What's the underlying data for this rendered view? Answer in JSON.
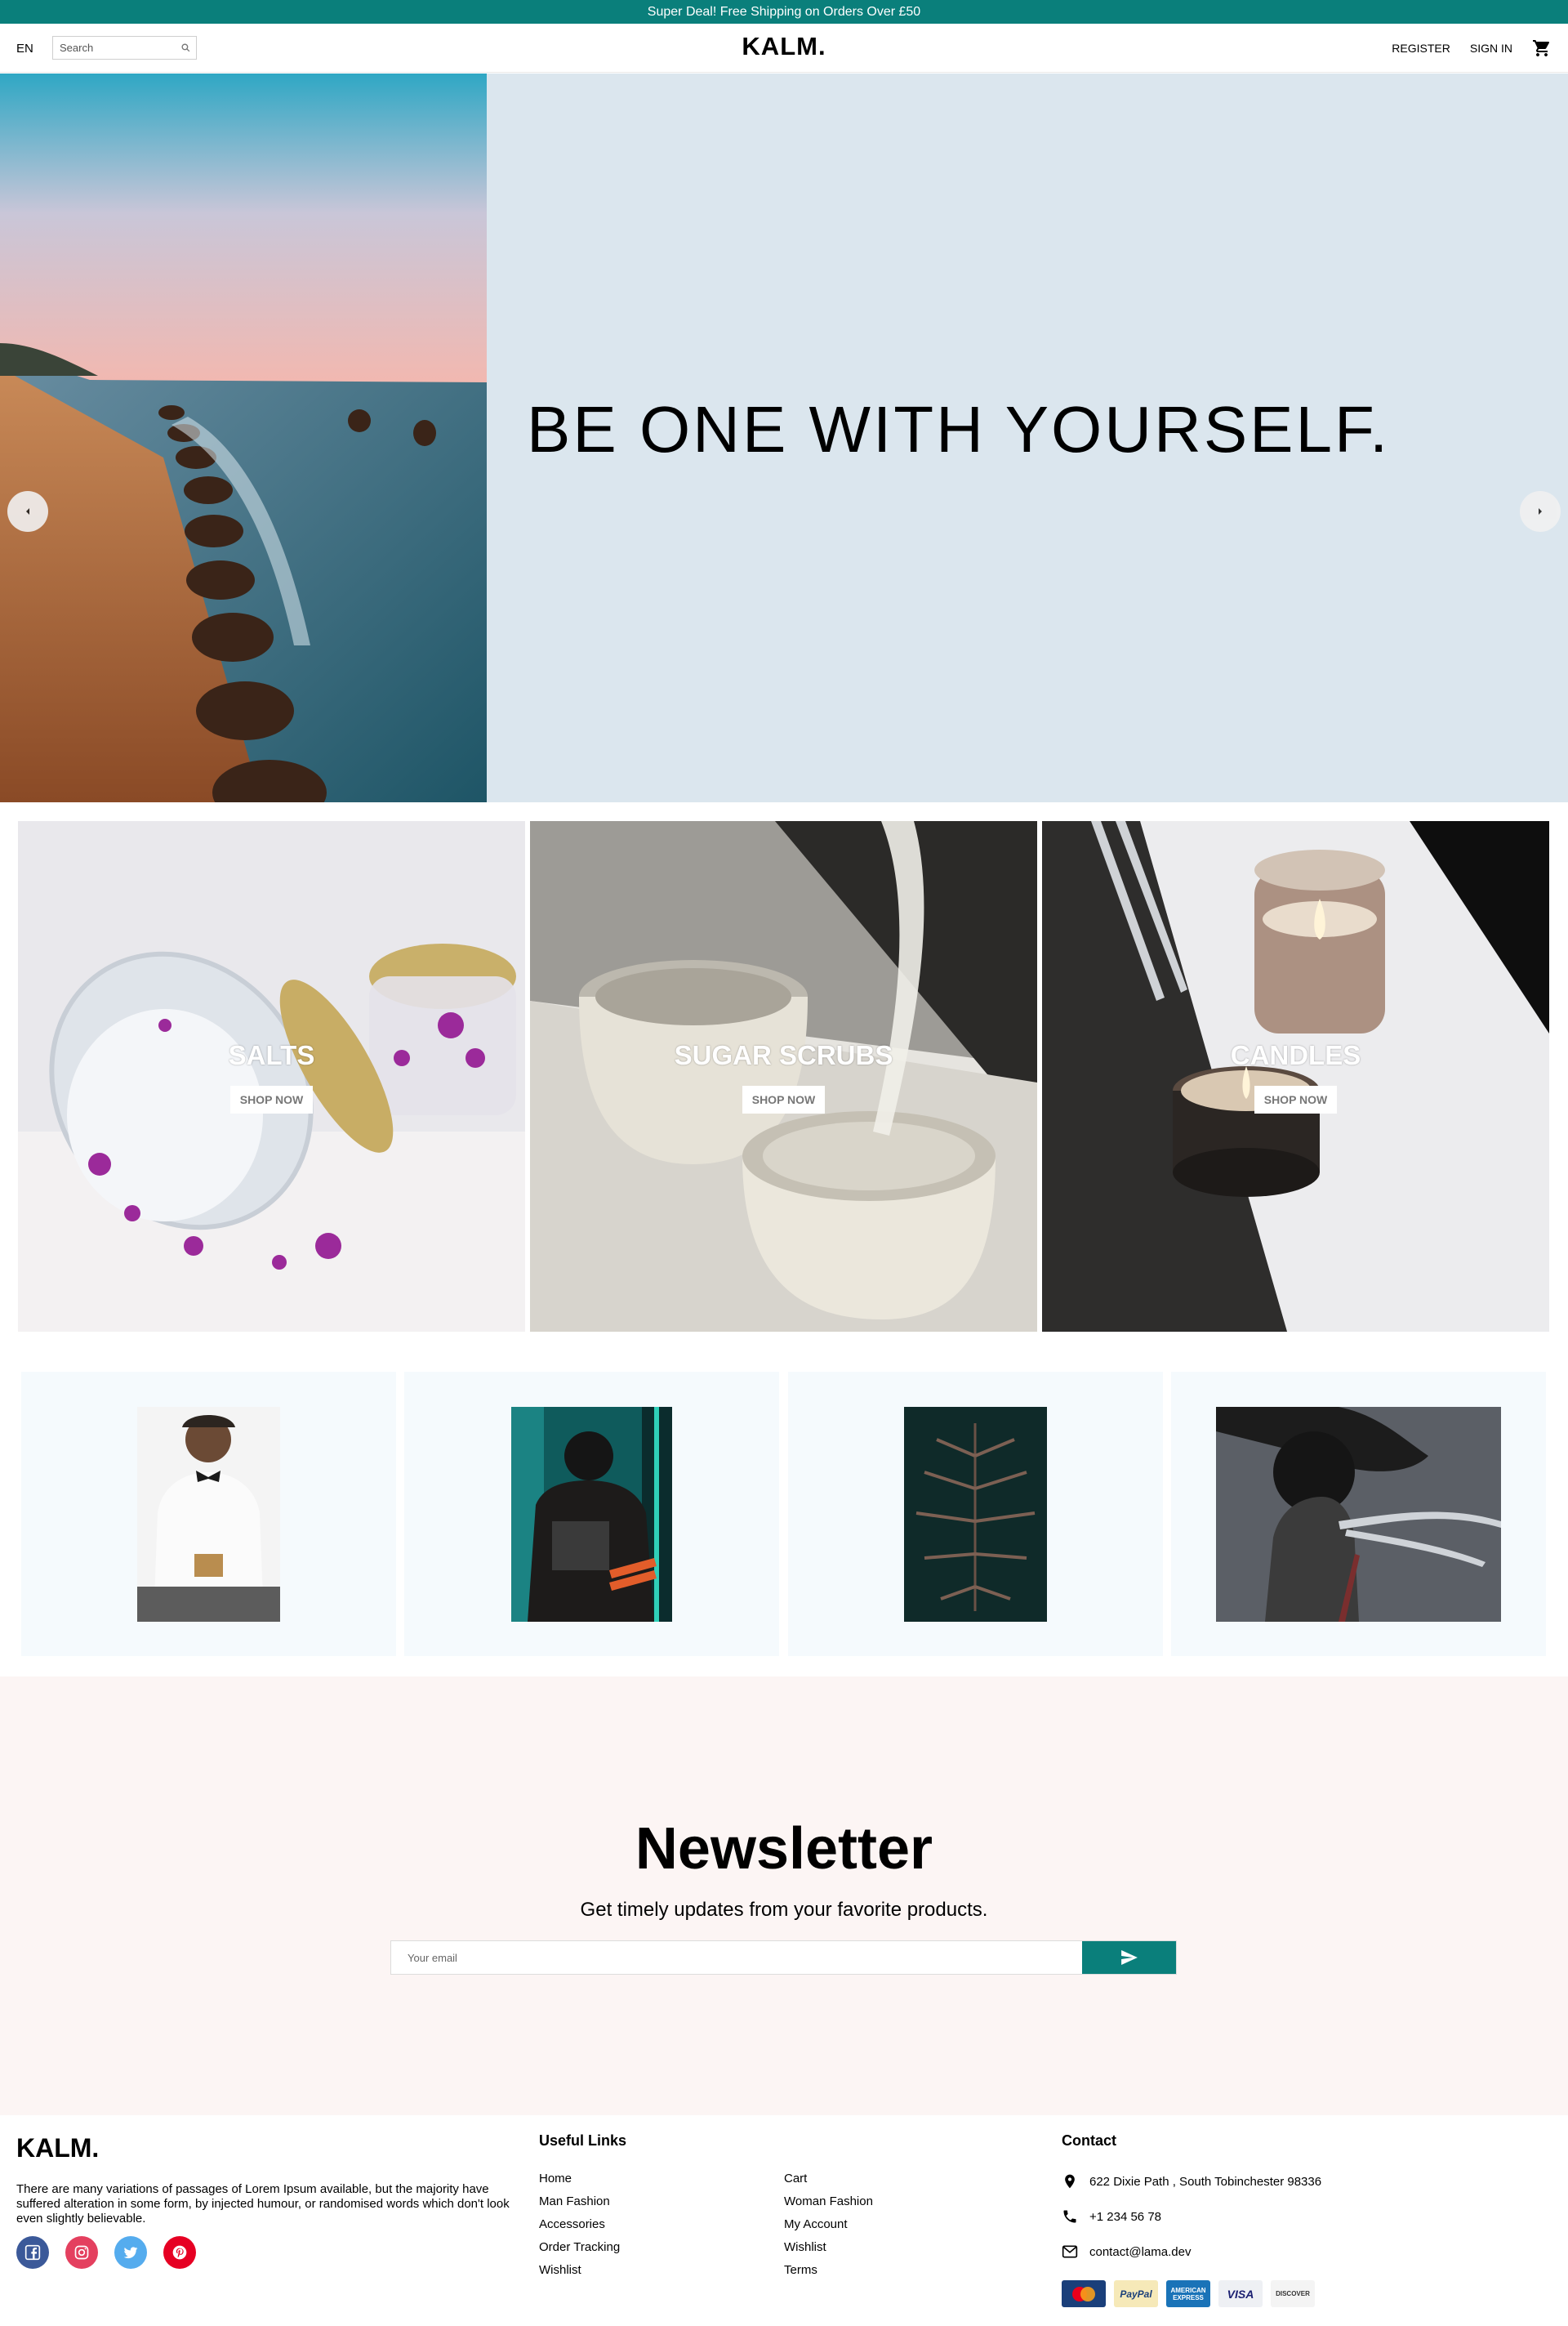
{
  "announcement": "Super Deal! Free Shipping on Orders Over £50",
  "header": {
    "language": "EN",
    "search_placeholder": "Search",
    "logo": "KALM.",
    "register": "REGISTER",
    "sign_in": "SIGN IN"
  },
  "hero": {
    "title": "BE ONE WITH YOURSELF."
  },
  "categories": [
    {
      "title": "SALTS",
      "button": "SHOP NOW"
    },
    {
      "title": "SUGAR SCRUBS",
      "button": "SHOP NOW"
    },
    {
      "title": "CANDLES",
      "button": "SHOP NOW"
    }
  ],
  "newsletter": {
    "title": "Newsletter",
    "description": "Get timely updates from your favorite products.",
    "email_placeholder": "Your email"
  },
  "footer": {
    "logo": "KALM.",
    "description": "There are many variations of passages of Lorem Ipsum available, but the majority have suffered alteration in some form, by injected humour, or randomised words which don't look even slightly believable.",
    "useful_links_heading": "Useful Links",
    "links_col1": [
      "Home",
      "Man Fashion",
      "Accessories",
      "Order Tracking",
      "Wishlist"
    ],
    "links_col2": [
      "Cart",
      "Woman Fashion",
      "My Account",
      "Wishlist",
      "Terms"
    ],
    "contact_heading": "Contact",
    "address": "622 Dixie Path , South Tobinchester 98336",
    "phone": "+1 234 56 78",
    "email": "contact@lama.dev",
    "social_icons": [
      "facebook-icon",
      "instagram-icon",
      "twitter-icon",
      "pinterest-icon"
    ],
    "social_colors": [
      "#3b5999",
      "#e4405f",
      "#55acee",
      "#e60023"
    ],
    "payment_methods": [
      "MasterCard",
      "PayPal",
      "AMERICAN EXPRESS",
      "VISA",
      "DISCOVER"
    ]
  },
  "colors": {
    "accent": "#0a7f7b",
    "hero_bg": "#dbe6ee",
    "newsletter_bg": "#fcf5f4",
    "product_bg": "#f5fafd"
  }
}
